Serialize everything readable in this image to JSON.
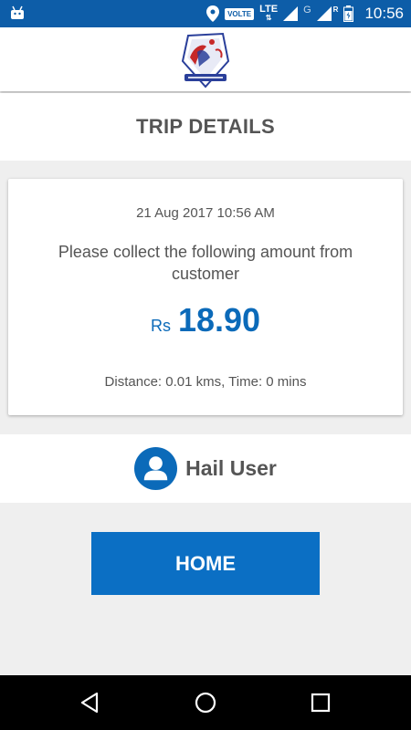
{
  "status_bar": {
    "time": "10:56",
    "volte": "VOLTE",
    "network_type": "LTE",
    "roaming_network": "G",
    "roaming_flag": "R",
    "icons": [
      "android-icon",
      "location-icon",
      "signal-icon",
      "battery-icon"
    ]
  },
  "header": {
    "logo_icon": "jack-logo-icon"
  },
  "page": {
    "title": "TRIP DETAILS"
  },
  "trip": {
    "datetime": "21 Aug 2017 10:56 AM",
    "message": "Please collect the following amount from customer",
    "currency": "Rs",
    "amount": "18.90",
    "distance_time": "Distance: 0.01 kms, Time: 0 mins"
  },
  "user": {
    "name": "Hail User",
    "avatar_icon": "user-avatar-icon"
  },
  "actions": {
    "home_label": "HOME"
  },
  "nav": {
    "icons": [
      "back-icon",
      "home-icon",
      "recents-icon"
    ]
  },
  "colors": {
    "status_bar": "#0d5da8",
    "accent": "#0b6fc4",
    "amount": "#0b6ab9",
    "text": "#555555",
    "background": "#efefef"
  }
}
